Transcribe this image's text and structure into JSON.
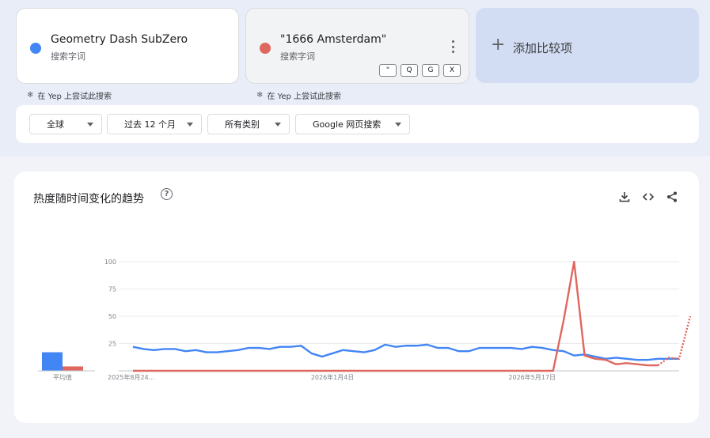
{
  "terms": [
    {
      "name": "Geometry Dash SubZero",
      "sub": "搜索字词",
      "color": "#4285f4"
    },
    {
      "name": "\"1666 Amsterdam\"",
      "sub": "搜索字词",
      "color": "#e0675e"
    }
  ],
  "term2_chips": [
    "\"",
    "Q",
    "G",
    "X"
  ],
  "add_compare": {
    "plus": "+",
    "label": "添加比较项"
  },
  "yep_text": "在 Yep 上尝试此搜索",
  "yep_icon": "❄",
  "filters": [
    "全球",
    "过去 12 个月",
    "所有类别",
    "Google 网页搜索"
  ],
  "card_title": "热度随时间变化的趋势",
  "help_glyph": "?",
  "chart_data": {
    "type": "line",
    "y_ticks": [
      "100",
      "75",
      "50",
      "25"
    ],
    "ylim": [
      0,
      100
    ],
    "x_ticks": [
      {
        "label": "2025年8月24...",
        "index": 0
      },
      {
        "label": "2026年1月4日",
        "index": 19
      },
      {
        "label": "2026年5月17日",
        "index": 38
      }
    ],
    "average_label": "平均值",
    "averages": [
      17,
      4
    ],
    "series": [
      {
        "color": "#4285f4",
        "values": [
          22,
          20,
          19,
          20,
          20,
          18,
          19,
          17,
          17,
          18,
          19,
          21,
          21,
          20,
          22,
          22,
          23,
          16,
          13,
          16,
          19,
          18,
          17,
          19,
          24,
          22,
          23,
          23,
          24,
          21,
          21,
          18,
          18,
          21,
          21,
          21,
          21,
          20,
          22,
          21,
          19,
          18,
          14,
          15,
          13,
          11,
          12,
          11,
          10,
          10,
          11,
          11,
          11
        ]
      },
      {
        "color": "#e0675e",
        "values": [
          0,
          0,
          0,
          0,
          0,
          0,
          0,
          0,
          0,
          0,
          0,
          0,
          0,
          0,
          0,
          0,
          0,
          0,
          0,
          0,
          0,
          0,
          0,
          0,
          0,
          0,
          0,
          0,
          0,
          0,
          0,
          0,
          0,
          0,
          0,
          0,
          0,
          0,
          0,
          0,
          0,
          46,
          100,
          14,
          11,
          10,
          6,
          7,
          6,
          5,
          5,
          12,
          11
        ],
        "partial_from": 51,
        "partial_last": 50
      }
    ]
  }
}
